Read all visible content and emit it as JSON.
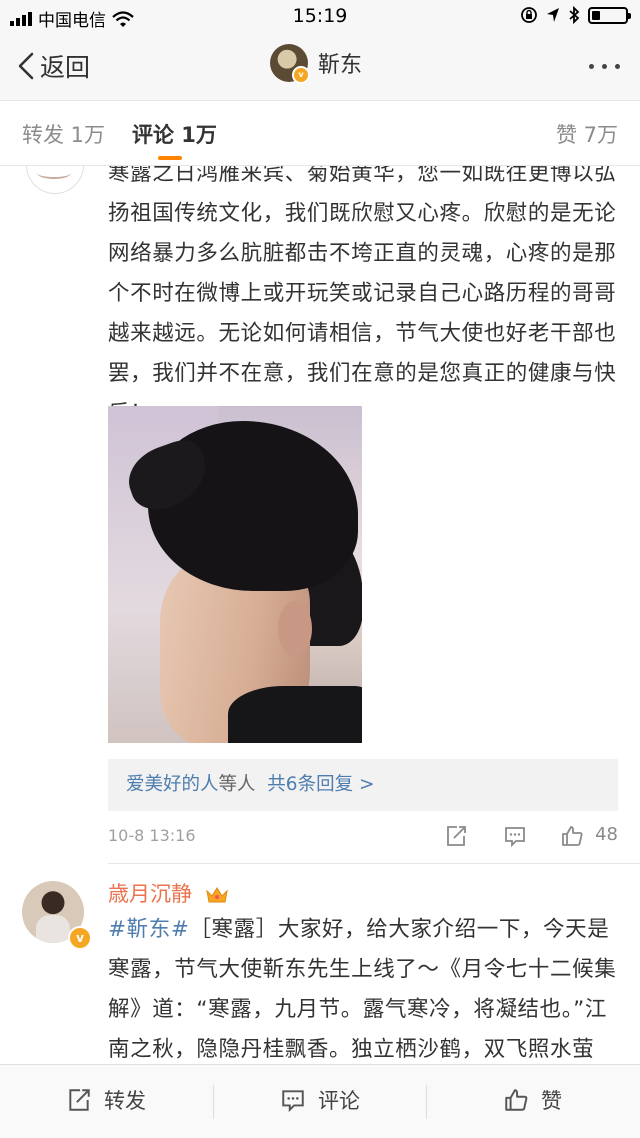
{
  "status_bar": {
    "carrier": "中国电信",
    "time": "15:19"
  },
  "nav": {
    "back_label": "返回",
    "title": "靳东"
  },
  "tabs": {
    "repost": "转发 1万",
    "comment": "评论 1万",
    "like": "赞 7万"
  },
  "comment1": {
    "text": "寒露之日鸿雁来宾、菊始黄华，您一如既往更博以弘扬祖国传统文化，我们既欣慰又心疼。欣慰的是无论网络暴力多么肮脏都击不垮正直的灵魂，心疼的是那个不时在微博上或开玩笑或记录自己心路历程的哥哥越来越远。无论如何请相信，节气大使也好老干部也罢，我们并不在意，我们在意的是您真正的健康与快乐！",
    "replies_user": "爱美好的人",
    "replies_mid": "等人",
    "replies_link": "共6条回复 >",
    "time": "10-8 13:16",
    "likes": "48"
  },
  "comment2": {
    "user": "歳月沉静",
    "topic": "#靳东#",
    "text": "［寒露］大家好，给大家介绍一下，今天是寒露，节气大使靳东先生上线了～《月令七十二候集解》道：“寒露，九月节。露气寒冷，将凝结也。”江南之秋，隐隐丹桂飘香。独立栖沙鹤，双飞照水萤"
  },
  "bottom_bar": {
    "repost": "转发",
    "comment": "评论",
    "like": "赞"
  },
  "colors": {
    "accent": "#ff8200",
    "link_blue": "#507daf",
    "username_orange": "#eb7350"
  }
}
